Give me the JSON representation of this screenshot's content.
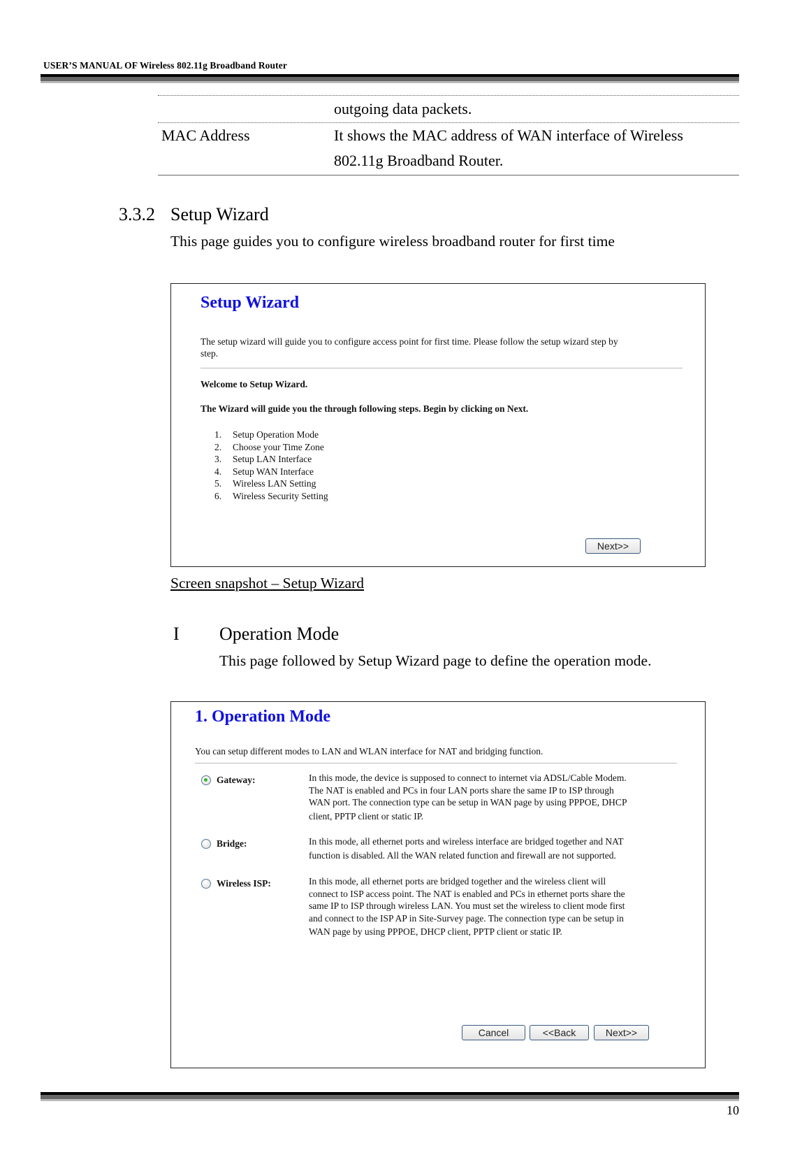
{
  "header": {
    "title": "USER’S MANUAL OF Wireless 802.11g Broadband Router"
  },
  "table": {
    "rows": [
      {
        "label": "",
        "desc_lines": [
          "outgoing data packets."
        ]
      },
      {
        "label": "MAC Address",
        "desc_lines": [
          "It shows the MAC address of WAN interface of Wireless",
          "802.11g Broadband Router."
        ]
      }
    ]
  },
  "section": {
    "number": "3.3.2",
    "title": "Setup Wizard",
    "description": "This page guides you to configure wireless broadband router for first time"
  },
  "setup_wizard_screen": {
    "heading": "Setup Wizard",
    "intro_line1": "The setup wizard will guide you to configure access point for first time. Please follow the setup wizard step by",
    "intro_line2": "step.",
    "welcome": "Welcome to Setup Wizard.",
    "guide": "The Wizard will guide you the through following steps. Begin by clicking on Next.",
    "steps": [
      {
        "num": "1.",
        "label": "Setup Operation Mode"
      },
      {
        "num": "2.",
        "label": "Choose your Time Zone"
      },
      {
        "num": "3.",
        "label": "Setup LAN Interface"
      },
      {
        "num": "4.",
        "label": "Setup WAN Interface"
      },
      {
        "num": "5.",
        "label": "Wireless LAN Setting"
      },
      {
        "num": "6.",
        "label": "Wireless Security Setting"
      }
    ],
    "next_label": "Next>>"
  },
  "caption": "Screen snapshot – Setup Wizard",
  "subsection": {
    "number": "I",
    "title": "Operation Mode",
    "description": "This page followed by Setup Wizard page to define the operation mode."
  },
  "operation_mode_screen": {
    "heading": "1. Operation Mode",
    "intro": "You can setup different modes to LAN and WLAN interface for NAT and bridging function.",
    "selected": "gateway",
    "options": [
      {
        "id": "gateway",
        "label": "Gateway:",
        "checked": true,
        "desc_lines": [
          "In this mode, the device is supposed to connect to internet via ADSL/Cable Modem.",
          "The NAT is enabled and PCs in four LAN ports share the same IP to ISP through",
          "WAN port. The connection type can be setup in WAN page by using PPPOE, DHCP",
          "client, PPTP client or static IP."
        ]
      },
      {
        "id": "bridge",
        "label": "Bridge:",
        "checked": false,
        "desc_lines": [
          "In this mode, all ethernet ports and wireless interface are bridged together and NAT",
          "function is disabled. All the WAN related function and firewall are not supported."
        ]
      },
      {
        "id": "wireless-isp",
        "label": "Wireless ISP:",
        "checked": false,
        "desc_lines": [
          "In this mode, all ethernet ports are bridged together and the wireless client will",
          "connect to ISP access point. The NAT is enabled and PCs in ethernet ports share the",
          "same IP to ISP through wireless LAN. You must set the wireless to client mode first",
          "and connect to the ISP AP in Site-Survey page. The connection type can be setup in",
          "WAN page by using PPPOE, DHCP client, PPTP client or static IP."
        ]
      }
    ],
    "buttons": {
      "cancel": "Cancel",
      "back": "<<Back",
      "next": "Next>>"
    }
  },
  "footer": {
    "page_number": "10"
  }
}
